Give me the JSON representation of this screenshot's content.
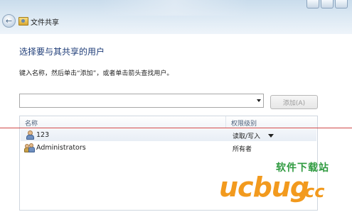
{
  "window": {
    "title": "文件共享"
  },
  "dialog": {
    "heading": "选择要与其共享的用户",
    "instruction": "键入名称，然后单击“添加”，或者单击箭头查找用户。",
    "input_value": "",
    "add_button_label": "添加(A)"
  },
  "table": {
    "columns": [
      "名称",
      "权限级别"
    ],
    "rows": [
      {
        "name": "123",
        "permission": "读取/写入",
        "icon": "user-icon",
        "selected": true
      },
      {
        "name": "Administrators",
        "permission": "所有者",
        "icon": "user-group-icon",
        "selected": false
      }
    ]
  },
  "watermark": {
    "chinese": "软件下载站",
    "logo_text": "ucbug",
    "suffix": "cc"
  },
  "colors": {
    "heading": "#1f3d78",
    "watermark_orange": "#f29a1e",
    "watermark_green": "#2e9a3f",
    "annotation_line": "#d04848"
  }
}
